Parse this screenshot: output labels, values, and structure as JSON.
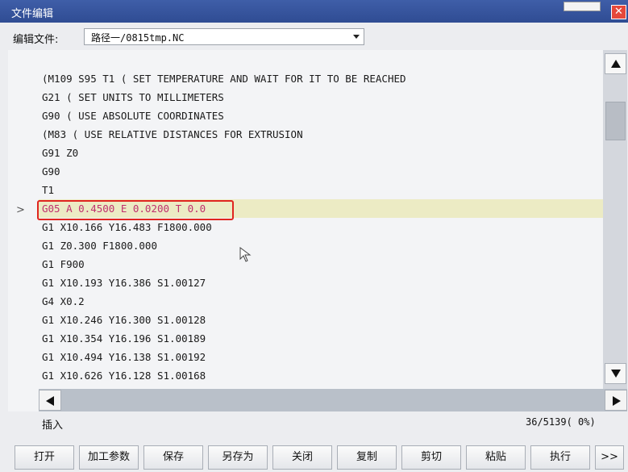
{
  "window": {
    "title": "文件编辑",
    "close_glyph": "✕"
  },
  "file_bar": {
    "label": "编辑文件:",
    "selected_file": "路径一/0815tmp.NC"
  },
  "editor": {
    "current_line_marker": ">",
    "lines": [
      "(M109 S95 T1 ( SET TEMPERATURE AND WAIT FOR IT TO BE REACHED",
      "G21 ( SET UNITS TO MILLIMETERS",
      "G90 ( USE ABSOLUTE COORDINATES",
      "(M83 ( USE RELATIVE DISTANCES FOR EXTRUSION",
      "G91 Z0",
      "G90",
      "T1",
      "G05 A 0.4500 E 0.0200 T 0.0",
      "G1 X10.166 Y16.483 F1800.000",
      "G1 Z0.300 F1800.000",
      "G1 F900",
      "G1 X10.193 Y16.386 S1.00127",
      "G4 X0.2",
      "G1 X10.246 Y16.300 S1.00128",
      "G1 X10.354 Y16.196 S1.00189",
      "G1 X10.494 Y16.138 S1.00192",
      "G1 X10.626 Y16.128 S1.00168"
    ],
    "current_line_index": 7
  },
  "status": {
    "mode": "插入",
    "position": "36/5139( 0%)"
  },
  "toolbar": {
    "open": "打开",
    "params": "加工参数",
    "save": "保存",
    "save_as": "另存为",
    "close": "关闭",
    "copy": "复制",
    "cut": "剪切",
    "paste": "粘贴",
    "execute": "执行",
    "more": ">>"
  },
  "colors": {
    "title_bar": "#2f4c93",
    "current_line_bg": "#ecebc4",
    "current_line_text": "#c0306d",
    "highlight_border": "#e0251f",
    "close_button": "#e5483a"
  }
}
